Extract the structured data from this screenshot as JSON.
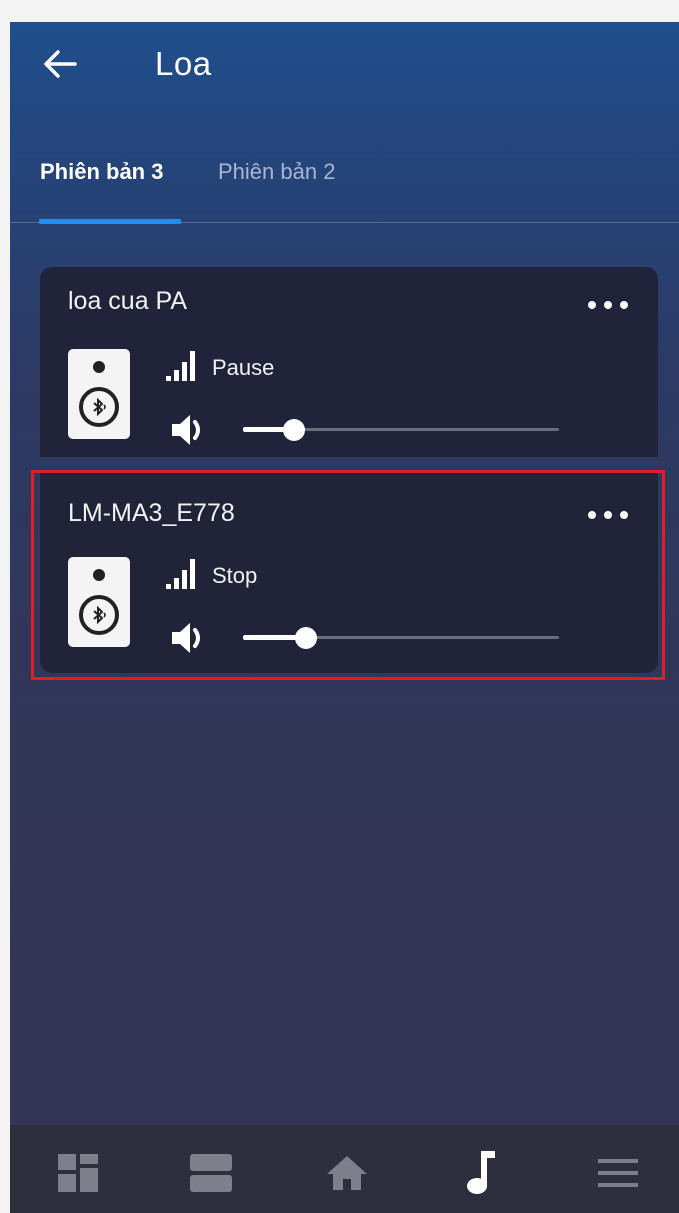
{
  "header": {
    "title": "Loa",
    "back_icon": "arrow-left-icon"
  },
  "tabs": [
    {
      "label": "Phiên bản 3",
      "active": true
    },
    {
      "label": "Phiên bản 2",
      "active": false
    }
  ],
  "speakers": [
    {
      "name": "loa cua PA",
      "status": "Pause",
      "volume_fraction": 0.16
    },
    {
      "name": "LM-MA3_E778",
      "status": "Stop",
      "volume_fraction": 0.2,
      "highlighted": true
    }
  ],
  "bottom_nav": [
    {
      "icon": "dashboard-icon",
      "active": false
    },
    {
      "icon": "rooms-icon",
      "active": false
    },
    {
      "icon": "home-icon",
      "active": false
    },
    {
      "icon": "music-note-icon",
      "active": true
    },
    {
      "icon": "menu-icon",
      "active": false
    }
  ],
  "colors": {
    "accent": "#1e8ef2",
    "highlight_border": "#e31c25",
    "card_bg": "#20233a"
  }
}
